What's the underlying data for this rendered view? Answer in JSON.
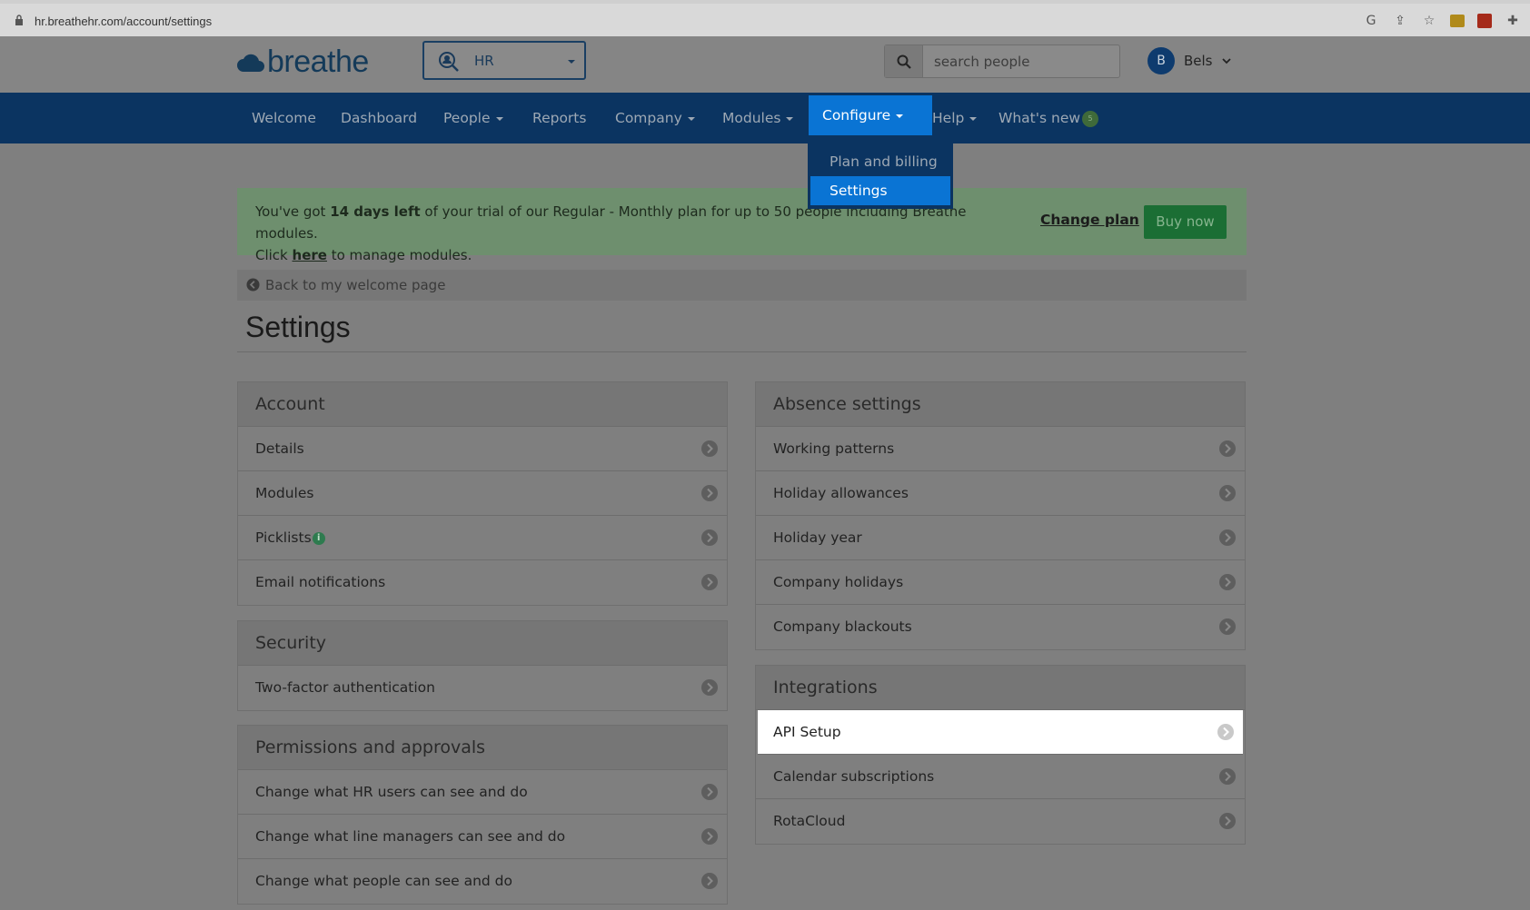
{
  "browser": {
    "url": "hr.breathehr.com/account/settings"
  },
  "header": {
    "logo_text": "breathe",
    "module_select": "HR",
    "search_placeholder": "search people",
    "user_initial": "B",
    "user_name": "Bels"
  },
  "nav": {
    "items": [
      {
        "label": "Welcome"
      },
      {
        "label": "Dashboard"
      },
      {
        "label": "People"
      },
      {
        "label": "Reports"
      },
      {
        "label": "Company"
      },
      {
        "label": "Modules"
      },
      {
        "label": "Configure"
      },
      {
        "label": "Help"
      },
      {
        "label": "What's new"
      }
    ],
    "whats_new_badge": "5",
    "configure_menu": [
      "Plan and billing",
      "Settings"
    ]
  },
  "trial": {
    "line1_pre": "You've got ",
    "line1_bold": "14 days left",
    "line1_post": " of your trial of our Regular - Monthly plan for up to 50 people including Breathe modules.",
    "line2_pre": "Click ",
    "line2_link": "here",
    "line2_post": " to manage modules.",
    "change_plan": "Change plan",
    "buy_now": "Buy now"
  },
  "back_link": "Back to my welcome page",
  "page_title": "Settings",
  "panels": {
    "account": {
      "title": "Account",
      "rows": [
        "Details",
        "Modules",
        "Picklists",
        "Email notifications"
      ]
    },
    "security": {
      "title": "Security",
      "rows": [
        "Two-factor authentication"
      ]
    },
    "permissions": {
      "title": "Permissions and approvals",
      "rows": [
        "Change what HR users can see and do",
        "Change what line managers can see and do",
        "Change what people can see and do"
      ]
    },
    "absence": {
      "title": "Absence settings",
      "rows": [
        "Working patterns",
        "Holiday allowances",
        "Holiday year",
        "Company holidays",
        "Company blackouts"
      ]
    },
    "integrations": {
      "title": "Integrations",
      "rows": [
        "API Setup",
        "Calendar subscriptions",
        "RotaCloud"
      ]
    }
  },
  "colors": {
    "nav_bg": "#0b3461",
    "nav_active": "#0a74d4",
    "buy_now": "#1b6e34"
  }
}
